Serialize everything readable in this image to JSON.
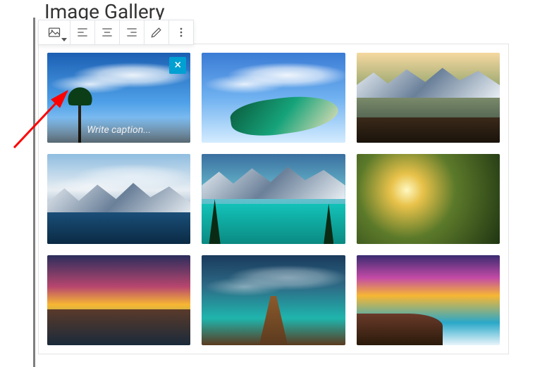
{
  "heading": "Image Gallery",
  "toolbar": {
    "block_type": "Gallery",
    "align_left": "Align left",
    "align_center": "Align center",
    "align_right": "Align right",
    "edit": "Edit",
    "more": "More options"
  },
  "selected": {
    "caption_placeholder": "Write caption...",
    "remove_label": "×"
  },
  "gallery": {
    "items": [
      {
        "alt": "Tropical beach with palm tree under blue sky",
        "selected": true
      },
      {
        "alt": "Aerial view of turquoise coastline and clouds",
        "selected": false
      },
      {
        "alt": "Mountain reflected in calm lake at sunrise",
        "selected": false
      },
      {
        "alt": "Snowy mountain range above blue lake",
        "selected": false
      },
      {
        "alt": "Turquoise alpine lake with pine trees and peaks",
        "selected": false
      },
      {
        "alt": "Sunbeams through forest trees on path",
        "selected": false
      },
      {
        "alt": "Dramatic sunset over canyon river",
        "selected": false
      },
      {
        "alt": "Wooden pier over tropical teal water",
        "selected": false
      },
      {
        "alt": "Vivid waterfall under colorful sunset sky",
        "selected": false
      }
    ]
  },
  "annotation": {
    "type": "arrow",
    "color": "#ff0000"
  }
}
